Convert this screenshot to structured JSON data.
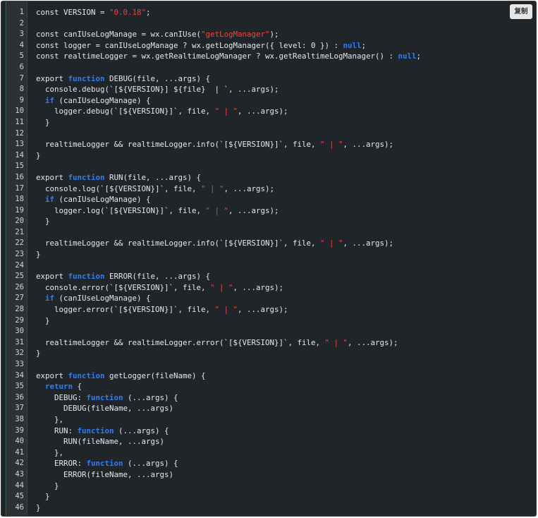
{
  "copy_button": {
    "label": "复制"
  },
  "colors": {
    "background": "#20252a",
    "keyword": "#2f7df6",
    "string": "#f0443b",
    "text": "#e6e8ea"
  },
  "line_numbers": [
    "1",
    "2",
    "3",
    "4",
    "5",
    "6",
    "7",
    "8",
    "9",
    "10",
    "11",
    "12",
    "13",
    "14",
    "15",
    "16",
    "17",
    "18",
    "19",
    "20",
    "21",
    "22",
    "23",
    "24",
    "25",
    "26",
    "27",
    "28",
    "29",
    "30",
    "31",
    "32",
    "33",
    "34",
    "35",
    "36",
    "37",
    "38",
    "39",
    "40",
    "41",
    "42",
    "43",
    "44",
    "45",
    "46"
  ],
  "code_lines": [
    [
      {
        "t": "const VERSION = "
      },
      {
        "t": "\"0.0.18\"",
        "c": "str"
      },
      {
        "t": ";"
      }
    ],
    [],
    [
      {
        "t": "const canIUseLogManage = wx.canIUse("
      },
      {
        "t": "\"getLogManager\"",
        "c": "str"
      },
      {
        "t": ");"
      }
    ],
    [
      {
        "t": "const logger = canIUseLogManage ? wx.getLogManager({ level: 0 }) : "
      },
      {
        "t": "null",
        "c": "kw"
      },
      {
        "t": ";"
      }
    ],
    [
      {
        "t": "const realtimeLogger = wx.getRealtimeLogManager ? wx.getRealtimeLogManager() : "
      },
      {
        "t": "null",
        "c": "kw"
      },
      {
        "t": ";"
      }
    ],
    [],
    [
      {
        "t": "export "
      },
      {
        "t": "function",
        "c": "kw"
      },
      {
        "t": " DEBUG(file, ...args) {"
      }
    ],
    [
      {
        "t": "  console.debug(`[${VERSION}] ${file}  | `, ...args);"
      }
    ],
    [
      {
        "t": "  "
      },
      {
        "t": "if",
        "c": "kw"
      },
      {
        "t": " (canIUseLogManage) {"
      }
    ],
    [
      {
        "t": "    logger.debug(`[${VERSION}]`, file, "
      },
      {
        "t": "\" | \"",
        "c": "str"
      },
      {
        "t": ", ...args);"
      }
    ],
    [
      {
        "t": "  }"
      }
    ],
    [],
    [
      {
        "t": "  realtimeLogger && realtimeLogger.info(`[${VERSION}]`, file, "
      },
      {
        "t": "\" | \"",
        "c": "str"
      },
      {
        "t": ", ...args);"
      }
    ],
    [
      {
        "t": "}"
      }
    ],
    [],
    [
      {
        "t": "export "
      },
      {
        "t": "function",
        "c": "kw"
      },
      {
        "t": " RUN(file, ...args) {"
      }
    ],
    [
      {
        "t": "  console.log(`[${VERSION}]`, file, "
      },
      {
        "t": "\" | \"",
        "c": "str"
      },
      {
        "t": ", ...args);"
      }
    ],
    [
      {
        "t": "  "
      },
      {
        "t": "if",
        "c": "kw"
      },
      {
        "t": " (canIUseLogManage) {"
      }
    ],
    [
      {
        "t": "    logger.log(`[${VERSION}]`, file, "
      },
      {
        "t": "\" | \"",
        "c": "str"
      },
      {
        "t": ", ...args);"
      }
    ],
    [
      {
        "t": "  }"
      }
    ],
    [],
    [
      {
        "t": "  realtimeLogger && realtimeLogger.info(`[${VERSION}]`, file, "
      },
      {
        "t": "\" | \"",
        "c": "str"
      },
      {
        "t": ", ...args);"
      }
    ],
    [
      {
        "t": "}"
      }
    ],
    [],
    [
      {
        "t": "export "
      },
      {
        "t": "function",
        "c": "kw"
      },
      {
        "t": " ERROR(file, ...args) {"
      }
    ],
    [
      {
        "t": "  console.error(`[${VERSION}]`, file, "
      },
      {
        "t": "\" | \"",
        "c": "str"
      },
      {
        "t": ", ...args);"
      }
    ],
    [
      {
        "t": "  "
      },
      {
        "t": "if",
        "c": "kw"
      },
      {
        "t": " (canIUseLogManage) {"
      }
    ],
    [
      {
        "t": "    logger.error(`[${VERSION}]`, file, "
      },
      {
        "t": "\" | \"",
        "c": "str"
      },
      {
        "t": ", ...args);"
      }
    ],
    [
      {
        "t": "  }"
      }
    ],
    [],
    [
      {
        "t": "  realtimeLogger && realtimeLogger.error(`[${VERSION}]`, file, "
      },
      {
        "t": "\" | \"",
        "c": "str"
      },
      {
        "t": ", ...args);"
      }
    ],
    [
      {
        "t": "}"
      }
    ],
    [],
    [
      {
        "t": "export "
      },
      {
        "t": "function",
        "c": "kw"
      },
      {
        "t": " getLogger(fileName) {"
      }
    ],
    [
      {
        "t": "  "
      },
      {
        "t": "return",
        "c": "kw"
      },
      {
        "t": " {"
      }
    ],
    [
      {
        "t": "    DEBUG: "
      },
      {
        "t": "function",
        "c": "kw"
      },
      {
        "t": " (...args) {"
      }
    ],
    [
      {
        "t": "      DEBUG(fileName, ...args)"
      }
    ],
    [
      {
        "t": "    },"
      }
    ],
    [
      {
        "t": "    RUN: "
      },
      {
        "t": "function",
        "c": "kw"
      },
      {
        "t": " (...args) {"
      }
    ],
    [
      {
        "t": "      RUN(fileName, ...args)"
      }
    ],
    [
      {
        "t": "    },"
      }
    ],
    [
      {
        "t": "    ERROR: "
      },
      {
        "t": "function",
        "c": "kw"
      },
      {
        "t": " (...args) {"
      }
    ],
    [
      {
        "t": "      ERROR(fileName, ...args)"
      }
    ],
    [
      {
        "t": "    }"
      }
    ],
    [
      {
        "t": "  }"
      }
    ],
    [
      {
        "t": "}"
      }
    ]
  ]
}
